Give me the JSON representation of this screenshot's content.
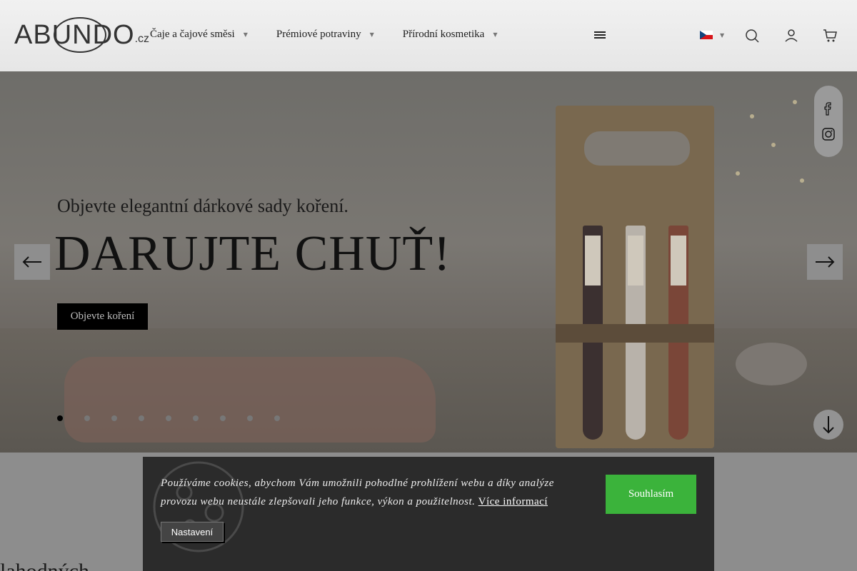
{
  "header": {
    "logo_text": "ABUNDO",
    "logo_tld": ".cz",
    "nav": [
      {
        "label": "Čaje a čajové směsi"
      },
      {
        "label": "Prémiové potraviny"
      },
      {
        "label": "Přírodní kosmetika"
      }
    ],
    "language": "cs",
    "icons": [
      "menu-icon",
      "search-icon",
      "user-icon",
      "cart-icon"
    ]
  },
  "hero": {
    "subtitle": "Objevte elegantní dárkové sady koření.",
    "title": "DARUJTE CHUŤ!",
    "button_label": "Objevte koření",
    "slides_count": 9,
    "active_slide": 1,
    "social": [
      "facebook-icon",
      "instagram-icon"
    ]
  },
  "below": {
    "partial_text": "lahodných"
  },
  "cookie": {
    "message": "Používáme cookies, abychom Vám umožnili pohodlné prohlížení webu a díky analýze provozu webu neustále zlepšovali jeho funkce, výkon a použitelnost.",
    "link_label": "Více informací",
    "accept_label": "Souhlasím",
    "settings_label": "Nastavení"
  },
  "colors": {
    "accept": "#3bb33b",
    "cookie_bg": "#2b2b2b",
    "header_bg": "#ececec"
  }
}
